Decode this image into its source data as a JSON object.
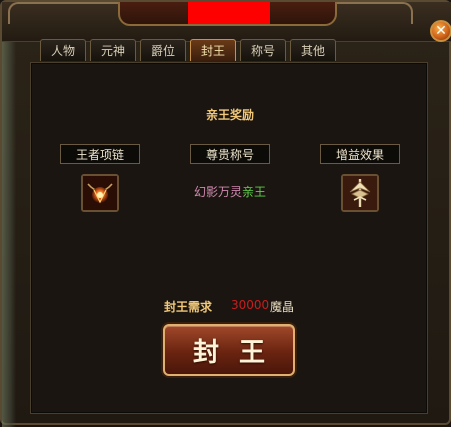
{
  "window": {
    "close_label": "✕"
  },
  "tabs": [
    {
      "label": "人物",
      "active": false
    },
    {
      "label": "元神",
      "active": false
    },
    {
      "label": "爵位",
      "active": false
    },
    {
      "label": "封王",
      "active": true
    },
    {
      "label": "称号",
      "active": false
    },
    {
      "label": "其他",
      "active": false
    }
  ],
  "reward": {
    "title": "亲王奖励",
    "necklace_label": "王者项链",
    "honor_label": "尊贵称号",
    "effect_label": "增益效果",
    "title_name": "幻影万灵亲王",
    "title_part1": "幻影万灵",
    "title_part2": "亲王",
    "necklace_icon": "necklace-icon",
    "effect_icon": "buff-icon"
  },
  "requirement": {
    "label": "封王需求",
    "amount": "30000",
    "unit": "魔晶"
  },
  "action": {
    "button_label": "封王"
  },
  "colors": {
    "gold_text": "#f0c878",
    "red_amount": "#c81e1e",
    "title_pink": "#d08ab0",
    "title_green": "#5fd04a"
  }
}
